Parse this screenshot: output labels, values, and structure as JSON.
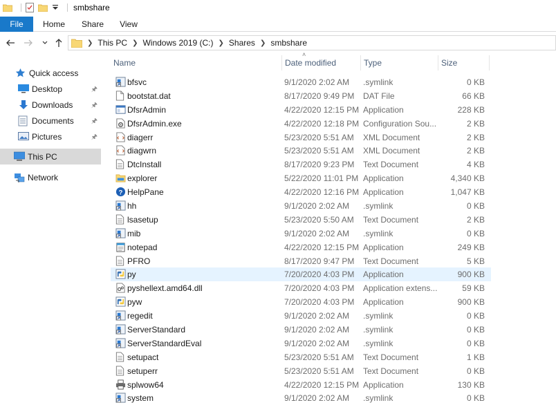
{
  "window": {
    "title": "smbshare"
  },
  "ribbon": {
    "tabs": [
      {
        "label": "File"
      },
      {
        "label": "Home"
      },
      {
        "label": "Share"
      },
      {
        "label": "View"
      }
    ]
  },
  "address": {
    "breadcrumbs": [
      "This PC",
      "Windows 2019 (C:)",
      "Shares",
      "smbshare"
    ]
  },
  "nav_pane": {
    "quick_access": "Quick access",
    "pinned": [
      {
        "label": "Desktop"
      },
      {
        "label": "Downloads"
      },
      {
        "label": "Documents"
      },
      {
        "label": "Pictures"
      }
    ],
    "this_pc": "This PC",
    "network": "Network"
  },
  "columns": {
    "name": "Name",
    "date": "Date modified",
    "type": "Type",
    "size": "Size"
  },
  "files": [
    {
      "name": "bfsvc",
      "date": "9/1/2020 2:02 AM",
      "type": ".symlink",
      "size": "0 KB",
      "icon": "symlink"
    },
    {
      "name": "bootstat.dat",
      "date": "8/17/2020 9:49 PM",
      "type": "DAT File",
      "size": "66 KB",
      "icon": "file"
    },
    {
      "name": "DfsrAdmin",
      "date": "4/22/2020 12:15 PM",
      "type": "Application",
      "size": "228 KB",
      "icon": "app"
    },
    {
      "name": "DfsrAdmin.exe",
      "date": "4/22/2020 12:18 PM",
      "type": "Configuration Sou...",
      "size": "2 KB",
      "icon": "config"
    },
    {
      "name": "diagerr",
      "date": "5/23/2020 5:51 AM",
      "type": "XML Document",
      "size": "2 KB",
      "icon": "xml"
    },
    {
      "name": "diagwrn",
      "date": "5/23/2020 5:51 AM",
      "type": "XML Document",
      "size": "2 KB",
      "icon": "xml"
    },
    {
      "name": "DtcInstall",
      "date": "8/17/2020 9:23 PM",
      "type": "Text Document",
      "size": "4 KB",
      "icon": "text"
    },
    {
      "name": "explorer",
      "date": "5/22/2020 11:01 PM",
      "type": "Application",
      "size": "4,340 KB",
      "icon": "explorer"
    },
    {
      "name": "HelpPane",
      "date": "4/22/2020 12:16 PM",
      "type": "Application",
      "size": "1,047 KB",
      "icon": "help"
    },
    {
      "name": "hh",
      "date": "9/1/2020 2:02 AM",
      "type": ".symlink",
      "size": "0 KB",
      "icon": "symlink"
    },
    {
      "name": "lsasetup",
      "date": "5/23/2020 5:50 AM",
      "type": "Text Document",
      "size": "2 KB",
      "icon": "text"
    },
    {
      "name": "mib",
      "date": "9/1/2020 2:02 AM",
      "type": ".symlink",
      "size": "0 KB",
      "icon": "symlink"
    },
    {
      "name": "notepad",
      "date": "4/22/2020 12:15 PM",
      "type": "Application",
      "size": "249 KB",
      "icon": "notepad"
    },
    {
      "name": "PFRO",
      "date": "8/17/2020 9:47 PM",
      "type": "Text Document",
      "size": "5 KB",
      "icon": "text"
    },
    {
      "name": "py",
      "date": "7/20/2020 4:03 PM",
      "type": "Application",
      "size": "900 KB",
      "icon": "python",
      "selected": true
    },
    {
      "name": "pyshellext.amd64.dll",
      "date": "7/20/2020 4:03 PM",
      "type": "Application extens...",
      "size": "59 KB",
      "icon": "dll"
    },
    {
      "name": "pyw",
      "date": "7/20/2020 4:03 PM",
      "type": "Application",
      "size": "900 KB",
      "icon": "python"
    },
    {
      "name": "regedit",
      "date": "9/1/2020 2:02 AM",
      "type": ".symlink",
      "size": "0 KB",
      "icon": "symlink"
    },
    {
      "name": "ServerStandard",
      "date": "9/1/2020 2:02 AM",
      "type": ".symlink",
      "size": "0 KB",
      "icon": "symlink"
    },
    {
      "name": "ServerStandardEval",
      "date": "9/1/2020 2:02 AM",
      "type": ".symlink",
      "size": "0 KB",
      "icon": "symlink"
    },
    {
      "name": "setupact",
      "date": "5/23/2020 5:51 AM",
      "type": "Text Document",
      "size": "1 KB",
      "icon": "text"
    },
    {
      "name": "setuperr",
      "date": "5/23/2020 5:51 AM",
      "type": "Text Document",
      "size": "0 KB",
      "icon": "text"
    },
    {
      "name": "splwow64",
      "date": "4/22/2020 12:15 PM",
      "type": "Application",
      "size": "130 KB",
      "icon": "printer"
    },
    {
      "name": "system",
      "date": "9/1/2020 2:02 AM",
      "type": ".symlink",
      "size": "0 KB",
      "icon": "symlink"
    }
  ],
  "colors": {
    "file_tab": "#1979ca",
    "selected_row": "#e5f3ff",
    "nav_selected": "#d9d9d9",
    "header_text": "#4c607a"
  }
}
